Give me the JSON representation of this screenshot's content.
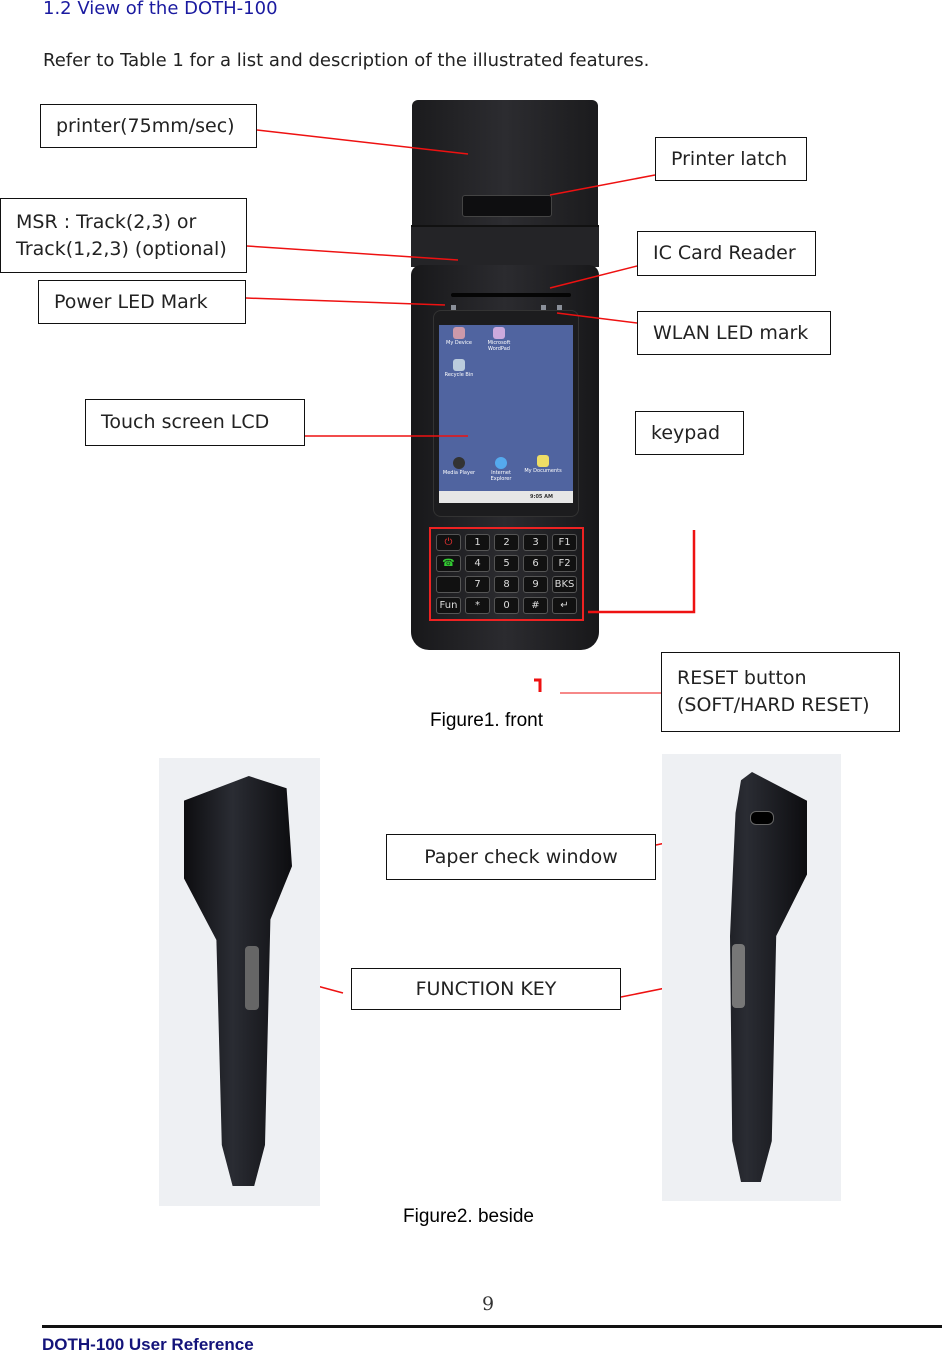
{
  "heading": "1.2 View of the DOTH-100",
  "intro": "Refer to Table 1 for a list and description of the illustrated features.",
  "figure1": {
    "caption": "Figure1. front",
    "callouts": {
      "printer": "printer(75mm/sec)",
      "msr_line1": "MSR  :  Track(2,3)  or",
      "msr_line2": "Track(1,2,3) (optional)",
      "power_led": "Power LED Mark",
      "touch_lcd": "Touch screen LCD",
      "printer_latch": "Printer latch",
      "ic_card": "IC Card Reader",
      "wlan_led": "WLAN LED mark",
      "keypad": "keypad",
      "reset_line1": "RESET button",
      "reset_line2": "(SOFT/HARD RESET)"
    },
    "screen": {
      "icons": [
        "My Device",
        "Microsoft WordPad",
        "Recycle Bin",
        "Media Player",
        "Internet Explorer",
        "My Documents"
      ],
      "clock": "9:05 AM"
    },
    "keys": [
      "",
      "1",
      "2",
      "3",
      "F1",
      "",
      "4",
      "5",
      "6",
      "F2",
      "",
      "7",
      "8",
      "9",
      "BKS",
      "Fun",
      "*",
      "0",
      "#",
      "↵"
    ],
    "colors": {
      "leader": "#ee1111",
      "callout_border": "#111111",
      "heading": "#1a1aa0"
    }
  },
  "figure2": {
    "caption": "Figure2. beside",
    "callouts": {
      "paper_check": "Paper check window",
      "function_key": "FUNCTION KEY"
    }
  },
  "page_number": "9",
  "footer": "DOTH-100 User Reference"
}
